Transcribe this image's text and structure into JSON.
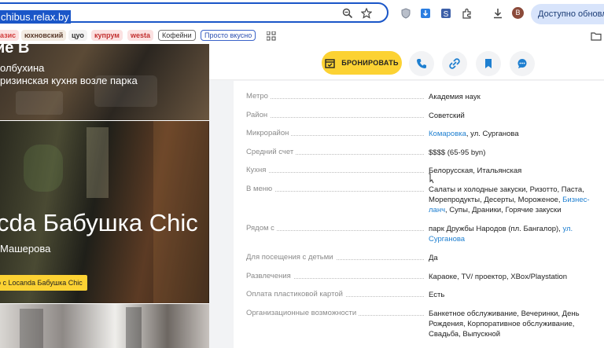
{
  "browser": {
    "tab_edge": "s",
    "url": "chibus.relax.by",
    "update_label": "Доступно обновление",
    "avatar_letter": "B",
    "bookmarks": [
      {
        "label": "азис",
        "color": "#d23b3b",
        "style": "plain"
      },
      {
        "label": "юхновский",
        "color": "#5a3b2b",
        "style": "plain"
      },
      {
        "label": "цуо",
        "color": "#333333",
        "style": "plain"
      },
      {
        "label": "купрум",
        "color": "#c23030",
        "style": "plain"
      },
      {
        "label": "westa",
        "color": "#c23030",
        "style": "plain"
      },
      {
        "label": "Кофейни",
        "color": "#333333",
        "style": "box"
      },
      {
        "label": "Просто вкусно",
        "color": "#2b4fb0",
        "style": "box2"
      }
    ]
  },
  "left_panels": {
    "p1_title": "ие В",
    "p1_sub1": "олбухина",
    "p1_sub2": "ризинская кухня возле парка",
    "p2_title": "cda Бабушка Chic",
    "p2_sub": "Машерова",
    "p2_cta": "о с Locanda Бабушка Chic"
  },
  "actions": {
    "book_label": "БРОНИРОВАТЬ",
    "accent": "#fcd233",
    "icon_color": "#1e7fd0"
  },
  "details": [
    {
      "label": "Метро",
      "value": "Академия наук"
    },
    {
      "label": "Район",
      "value": "Советский"
    },
    {
      "label": "Микрорайон",
      "link": "Комаровка",
      "value": ", ул. Сурганова"
    },
    {
      "label": "Средний счет",
      "value": "$$$$ (65-95 byn)"
    },
    {
      "label": "Кухня",
      "value": "Белорусская, Итальянская"
    },
    {
      "label": "В меню",
      "value": "Салаты и холодные закуски, Ризотто, Паста, Морепродукты, Десерты, Мороженое, ",
      "link": "Бизнес-ланч",
      "value2": ", Супы, Драники, Горячие закуски"
    },
    {
      "label": "Рядом с",
      "value": "парк Дружбы Народов (пл. Бангалор), ",
      "link": "ул. Сурганова"
    },
    {
      "label": "Для посещения с детьми",
      "value": "Да"
    },
    {
      "label": "Развлечения",
      "value": "Караоке, TV/ проектор, XBox/Playstation"
    },
    {
      "label": "Оплата пластиковой картой",
      "value": "Есть"
    },
    {
      "label": "Организационные возможности",
      "value": "Банкетное обслуживание, Вечеринки, День Рождения, Корпоративное обслуживание, Свадьба, Выпускной"
    }
  ]
}
